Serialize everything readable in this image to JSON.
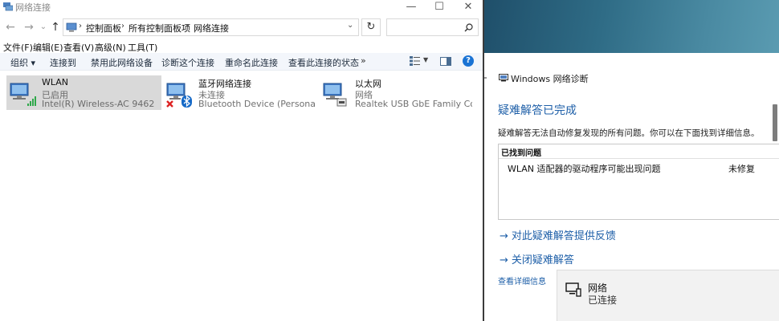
{
  "explorer": {
    "title": "网络连接",
    "window_buttons": {
      "minimize": "—",
      "maximize": "☐",
      "close": "✕"
    },
    "nav": {
      "back": "←",
      "forward": "→",
      "recent": "⌄",
      "up": "↑"
    },
    "breadcrumb": [
      "控制面板",
      "所有控制面板项",
      "网络连接"
    ],
    "breadcrumb_separator": "›",
    "refresh_glyph": "↻",
    "search_placeholder": "",
    "menu": [
      "文件(F)",
      "编辑(E)",
      "查看(V)",
      "高级(N)",
      "工具(T)"
    ],
    "commands": [
      "组织 ▾",
      "连接到",
      "禁用此网络设备",
      "诊断这个连接",
      "重命名此连接",
      "查看此连接的状态"
    ],
    "more": "»",
    "help_glyph": "?",
    "adapters": [
      {
        "name": "WLAN",
        "status": "已启用",
        "device": "Intel(R) Wireless-AC 9462",
        "icon": "wifi-adapter-icon",
        "selected": true
      },
      {
        "name": "蓝牙网络连接",
        "status": "未连接",
        "device": "Bluetooth Device (Personal Are...",
        "icon": "bluetooth-adapter-icon",
        "selected": false
      },
      {
        "name": "以太网",
        "status": "网络",
        "device": "Realtek USB GbE Family Contr...",
        "icon": "ethernet-adapter-icon",
        "selected": false
      }
    ]
  },
  "diagnostics": {
    "title": "Windows 网络诊断",
    "heading": "疑难解答已完成",
    "description": "疑难解答无法自动修复发现的所有问题。你可以在下面找到详细信息。",
    "found_header": "已找到问题",
    "issues": [
      {
        "text": "WLAN 适配器的驱动程序可能出现问题",
        "status": "未修复"
      }
    ],
    "links": [
      "对此疑难解答提供反馈",
      "关闭疑难解答"
    ],
    "link_arrow": "→",
    "details_link": "查看详细信息"
  },
  "network_flyout": {
    "name": "网络",
    "status": "已连接"
  },
  "colors": {
    "accent": "#1e5fa8",
    "selection": "#d9d9d9",
    "desktop": "#2f6c86",
    "help": "#1a73d4"
  }
}
